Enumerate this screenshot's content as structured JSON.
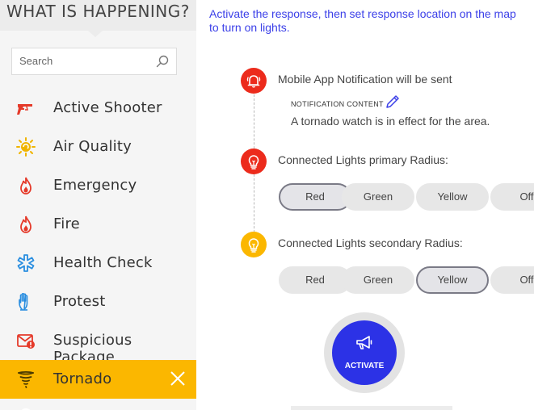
{
  "sidebar": {
    "title": "WHAT IS HAPPENING?",
    "search_placeholder": "Search",
    "items": [
      {
        "label": "Active Shooter",
        "icon": "gun-icon"
      },
      {
        "label": "Air Quality",
        "icon": "sun-icon"
      },
      {
        "label": "Emergency",
        "icon": "flame-icon"
      },
      {
        "label": "Fire",
        "icon": "flame-icon"
      },
      {
        "label": "Health Check",
        "icon": "medical-star-icon"
      },
      {
        "label": "Protest",
        "icon": "raised-hand-icon"
      },
      {
        "label": "Suspicious Package",
        "icon": "mail-alert-icon"
      },
      {
        "label": "Tornado",
        "icon": "tornado-icon",
        "active": true
      }
    ]
  },
  "main": {
    "instructions": "Activate the response, then set response location on the map to turn on lights.",
    "steps": {
      "notification": {
        "label": "Mobile App Notification will be sent",
        "content_heading": "NOTIFICATION CONTENT",
        "content_text": "A tornado watch is in effect for the area."
      },
      "primary": {
        "label": "Connected Lights primary Radius:",
        "options": [
          "Red",
          "Green",
          "Yellow",
          "Off"
        ],
        "selected": "Red"
      },
      "secondary": {
        "label": "Connected Lights secondary Radius:",
        "options": [
          "Red",
          "Green",
          "Yellow",
          "Off"
        ],
        "selected": "Yellow"
      }
    },
    "activate_label": "ACTIVATE"
  },
  "colors": {
    "accent_blue": "#2c32e6",
    "instruction_text": "#3c40e8",
    "alert_red": "#ec2b1c",
    "warning_yellow": "#fbb700"
  }
}
